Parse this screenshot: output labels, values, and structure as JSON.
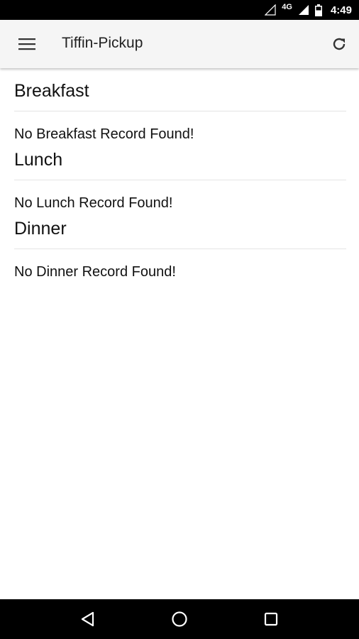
{
  "status_bar": {
    "network": "4G",
    "time": "4:49"
  },
  "app_bar": {
    "title": "Tiffin-Pickup",
    "menu_icon": "hamburger-menu-icon",
    "refresh_icon": "refresh-icon"
  },
  "sections": [
    {
      "heading": "Breakfast",
      "message": "No Breakfast Record Found!"
    },
    {
      "heading": "Lunch",
      "message": "No Lunch Record Found!"
    },
    {
      "heading": "Dinner",
      "message": "No Dinner Record Found!"
    }
  ],
  "nav_bar": {
    "back_icon": "back-triangle-icon",
    "home_icon": "home-circle-icon",
    "recents_icon": "recents-square-icon"
  },
  "colors": {
    "app_bar_bg": "#f5f5f5",
    "status_bar_bg": "#000000",
    "nav_bar_bg": "#000000",
    "divider": "#e4e4e4"
  }
}
